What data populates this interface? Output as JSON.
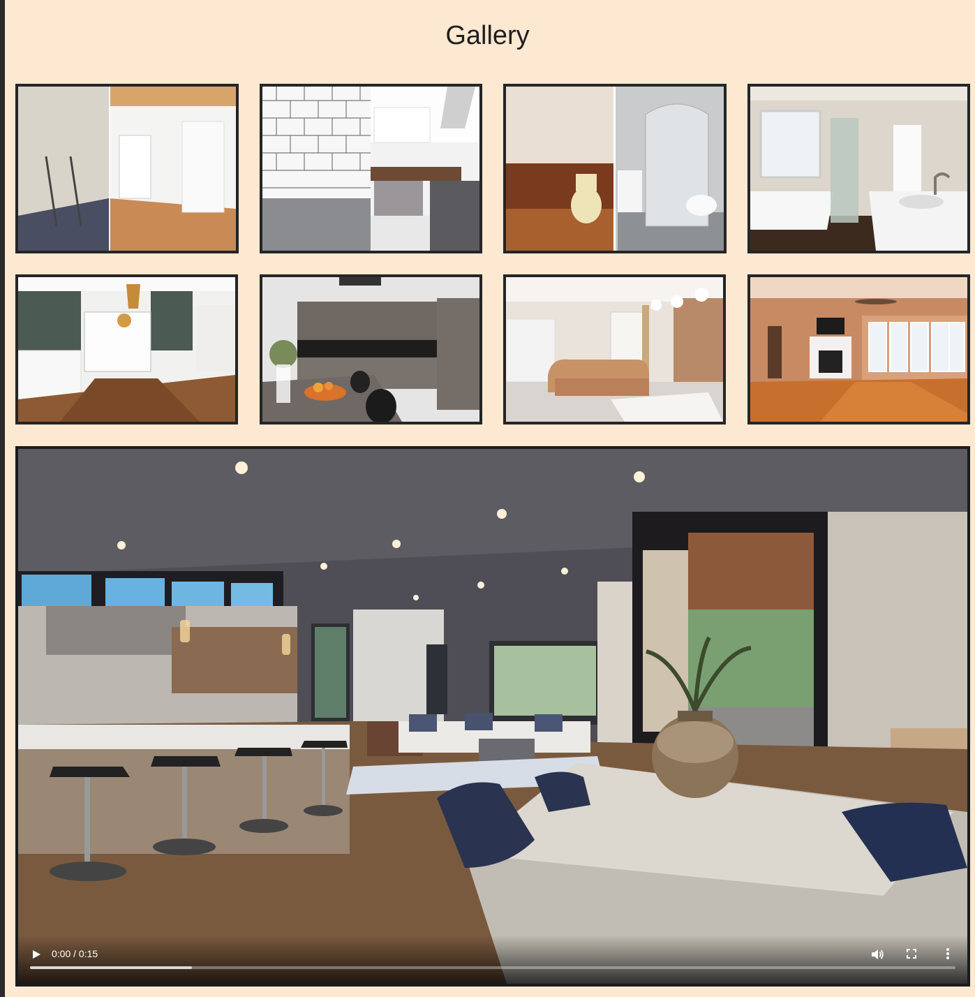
{
  "page": {
    "title": "Gallery"
  },
  "colors": {
    "background": "#fde8d1",
    "frame": "#252525"
  },
  "gallery": {
    "images": [
      {
        "icon": "room-renovation-before-after-image"
      },
      {
        "icon": "kitchen-before-after-image"
      },
      {
        "icon": "bathroom-before-after-image"
      },
      {
        "icon": "bathroom-bathtub-image"
      },
      {
        "icon": "dining-room-image"
      },
      {
        "icon": "modern-kitchen-image"
      },
      {
        "icon": "living-room-sofa-image"
      },
      {
        "icon": "living-room-fireplace-image"
      }
    ]
  },
  "video": {
    "time_display": "0:00 / 0:15",
    "progress": 0.175,
    "icons": [
      "play-icon",
      "volume-icon",
      "fullscreen-icon",
      "more-options-icon"
    ]
  }
}
